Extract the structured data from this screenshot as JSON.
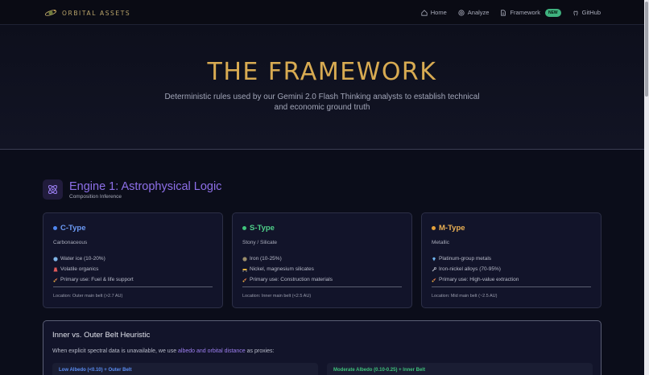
{
  "nav": {
    "brand": "ORBITAL ASSETS",
    "links": [
      {
        "label": "Home",
        "icon": "home-icon"
      },
      {
        "label": "Analyze",
        "icon": "target-icon"
      },
      {
        "label": "Framework",
        "icon": "document-icon",
        "badge": "NEW"
      },
      {
        "label": "GitHub",
        "icon": "github-icon"
      }
    ]
  },
  "hero": {
    "title": "THE FRAMEWORK",
    "subtitle": "Deterministic rules used by our Gemini 2.0 Flash Thinking analysts to establish technical and economic ground truth"
  },
  "engine": {
    "title": "Engine 1: Astrophysical Logic",
    "subtitle": "Composition Inference",
    "icon": "atom-icon"
  },
  "cards": [
    {
      "title": "C-Type",
      "color": "#4f86f0",
      "kind": "Carbonaceous",
      "items": [
        {
          "icon": "water-icon",
          "text": "Water ice (10-20%)"
        },
        {
          "icon": "beaker-icon",
          "text": "Volatile organics"
        },
        {
          "icon": "rocket-icon",
          "text": "Primary use: Fuel & life support"
        }
      ],
      "location": "Location: Outer main belt (>2.7 AU)"
    },
    {
      "title": "S-Type",
      "color": "#3fc37c",
      "kind": "Stony / Silicate",
      "items": [
        {
          "icon": "rock-icon",
          "text": "Iron (10-25%)"
        },
        {
          "icon": "construction-icon",
          "text": "Nickel, magnesium silicates"
        },
        {
          "icon": "rocket-icon",
          "text": "Primary use: Construction materials"
        }
      ],
      "location": "Location: Inner main belt (<2.5 AU)"
    },
    {
      "title": "M-Type",
      "color": "#e4a13a",
      "kind": "Metallic",
      "items": [
        {
          "icon": "gem-icon",
          "text": "Platinum-group metals"
        },
        {
          "icon": "wrench-icon",
          "text": "Iron-nickel alloys (70-95%)"
        },
        {
          "icon": "rocket-icon",
          "text": "Primary use: High-value extraction"
        }
      ],
      "location": "Location: Mid main belt (~2.5 AU)"
    }
  ],
  "heuristic": {
    "title": "Inner vs. Outer Belt Heuristic",
    "text_before": "When explicit spectral data is unavailable, we use ",
    "link": "albedo and orbital distance",
    "text_after": " as proxies:",
    "boxes": [
      {
        "label": "Low Albedo (<0.10) + Outer Belt",
        "color": "#5b8ef5"
      },
      {
        "label": "Moderate Albedo (0.10-0.25) + Inner Belt",
        "color": "#3fc37c"
      }
    ]
  }
}
